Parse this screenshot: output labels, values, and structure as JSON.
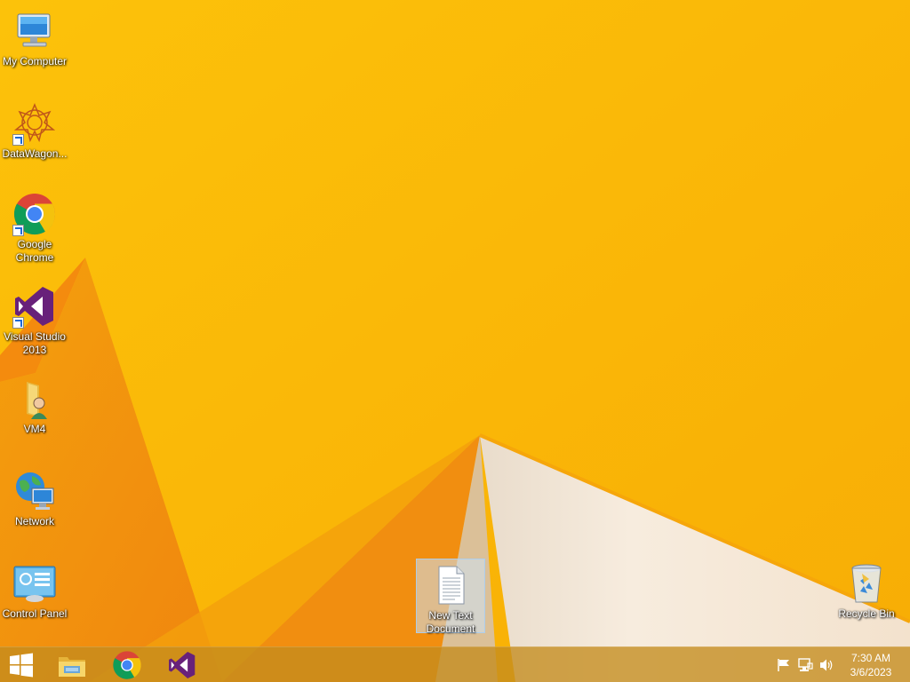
{
  "desktop": {
    "icons": [
      {
        "label": "My Computer"
      },
      {
        "label": "DataWagon..."
      },
      {
        "label": "Google\nChrome"
      },
      {
        "label": "Visual Studio\n2013"
      },
      {
        "label": "VM4"
      },
      {
        "label": "Network"
      },
      {
        "label": "Control Panel"
      },
      {
        "label": "New Text\nDocument"
      },
      {
        "label": "Recycle Bin"
      }
    ]
  },
  "taskbar": {
    "pinned": [
      {
        "icon": "windows-start-icon"
      },
      {
        "icon": "file-explorer-icon"
      },
      {
        "icon": "chrome-icon"
      },
      {
        "icon": "visual-studio-icon"
      }
    ],
    "tray": [
      {
        "icon": "action-center-flag-icon"
      },
      {
        "icon": "network-icon"
      },
      {
        "icon": "volume-icon"
      }
    ],
    "clock": {
      "time": "7:30 AM",
      "date": "3/6/2023"
    }
  },
  "colors": {
    "wallpaper_base": "#fbb403",
    "wallpaper_dark": "#f08a0c",
    "wallpaper_light": "#f6ead8",
    "taskbar": "#c48c1e"
  }
}
